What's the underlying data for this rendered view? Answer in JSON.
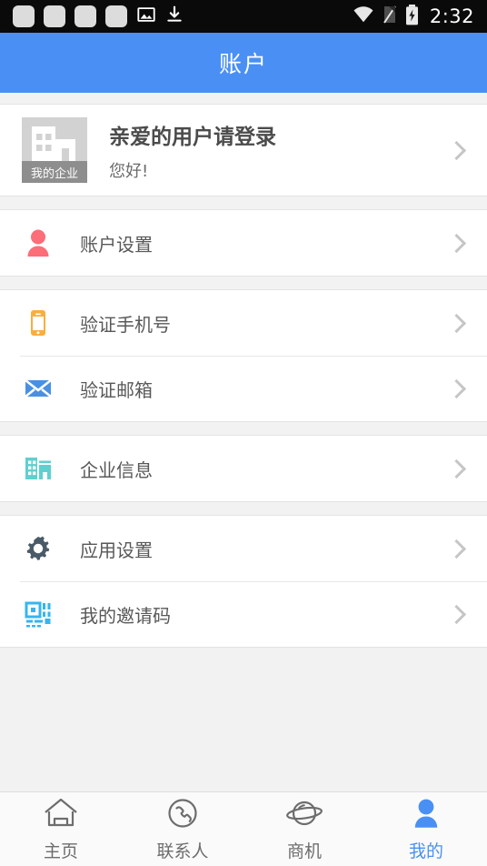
{
  "statusbar": {
    "time": "2:32",
    "placeholder_count": 4,
    "icons": [
      "image-icon",
      "download-icon",
      "wifi-icon",
      "sim-off-icon",
      "battery-charging-icon"
    ]
  },
  "header": {
    "title": "账户"
  },
  "profile": {
    "avatar_tag": "我的企业",
    "title": "亲爱的用户请登录",
    "subtitle": "您好!"
  },
  "sections": [
    {
      "items": [
        {
          "label": "账户设置",
          "icon": "person-icon",
          "color": "#fc6e78"
        }
      ]
    },
    {
      "items": [
        {
          "label": "验证手机号",
          "icon": "phone-icon",
          "color": "#f9ae3d"
        },
        {
          "label": "验证邮箱",
          "icon": "envelope-icon",
          "color": "#4a90e2"
        }
      ]
    },
    {
      "items": [
        {
          "label": "企业信息",
          "icon": "building-icon",
          "color": "#5fd0cf"
        }
      ]
    },
    {
      "items": [
        {
          "label": "应用设置",
          "icon": "gear-icon",
          "color": "#4a5a68"
        },
        {
          "label": "我的邀请码",
          "icon": "qrcode-icon",
          "color": "#36b5f0"
        }
      ]
    }
  ],
  "tabbar": {
    "active_index": 3,
    "tabs": [
      {
        "label": "主页",
        "icon": "home-icon"
      },
      {
        "label": "联系人",
        "icon": "contacts-phone-icon"
      },
      {
        "label": "商机",
        "icon": "planet-icon"
      },
      {
        "label": "我的",
        "icon": "user-icon"
      }
    ]
  },
  "colors": {
    "accent": "#4a90f4",
    "page_bg": "#f2f2f2",
    "card_bg": "#ffffff"
  }
}
